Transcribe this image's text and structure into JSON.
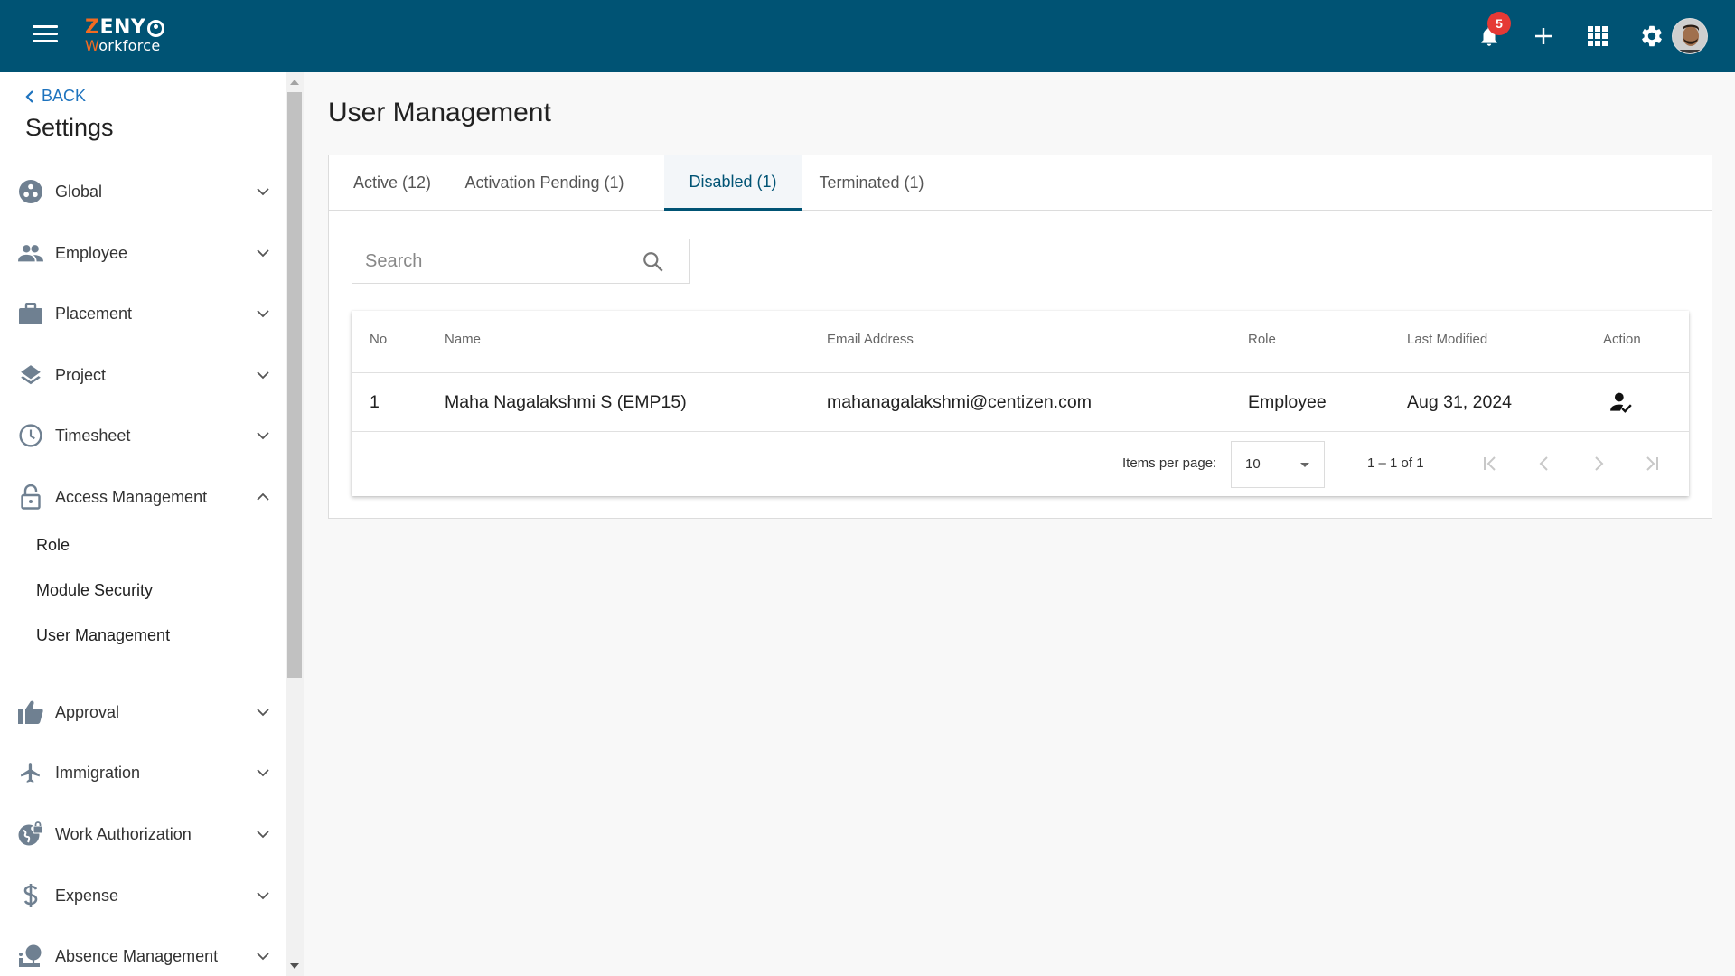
{
  "header": {
    "logo_top_first": "Z",
    "logo_top_rest": "ENY",
    "logo_bottom_first": "W",
    "logo_bottom_rest": "orkforce",
    "notifications_count": "5",
    "icons": [
      "menu-icon",
      "bell-icon",
      "plus-icon",
      "apps-grid-icon",
      "gear-icon",
      "user-avatar"
    ],
    "brand_color": "#005374",
    "accent_color": "#f26b21"
  },
  "sidebar": {
    "back_label": "BACK",
    "title": "Settings",
    "items": [
      {
        "label": "Global",
        "icon": "global-icon",
        "expanded": false
      },
      {
        "label": "Employee",
        "icon": "people-icon",
        "expanded": false
      },
      {
        "label": "Placement",
        "icon": "briefcase-icon",
        "expanded": false
      },
      {
        "label": "Project",
        "icon": "layers-icon",
        "expanded": false
      },
      {
        "label": "Timesheet",
        "icon": "clock-icon",
        "expanded": false
      },
      {
        "label": "Access Management",
        "icon": "lock-icon",
        "expanded": true,
        "children": [
          "Role",
          "Module Security",
          "User Management"
        ]
      },
      {
        "label": "Approval",
        "icon": "thumbs-up-icon",
        "expanded": false
      },
      {
        "label": "Immigration",
        "icon": "airplane-icon",
        "expanded": false
      },
      {
        "label": "Work Authorization",
        "icon": "globe-lock-icon",
        "expanded": false
      },
      {
        "label": "Expense",
        "icon": "dollar-icon",
        "expanded": false
      },
      {
        "label": "Absence Management",
        "icon": "absence-icon",
        "expanded": false
      }
    ]
  },
  "main": {
    "title": "User Management",
    "tabs": [
      {
        "label": "Active (12)",
        "active": false
      },
      {
        "label": "Activation Pending (1)",
        "active": false
      },
      {
        "label": "Disabled (1)",
        "active": true
      },
      {
        "label": "Terminated (1)",
        "active": false
      }
    ],
    "search": {
      "placeholder": "Search",
      "value": ""
    },
    "table": {
      "columns": [
        "No",
        "Name",
        "Email Address",
        "Role",
        "Last Modified",
        "Action"
      ],
      "rows": [
        {
          "no": "1",
          "name": "Maha Nagalakshmi S (EMP15)",
          "email": "mahanagalakshmi@centizen.com",
          "role": "Employee",
          "last_modified": "Aug 31, 2024",
          "action_icon": "enable-user-icon"
        }
      ]
    },
    "paginator": {
      "items_per_page_label": "Items per page:",
      "items_per_page": "10",
      "range": "1 – 1 of 1"
    }
  }
}
